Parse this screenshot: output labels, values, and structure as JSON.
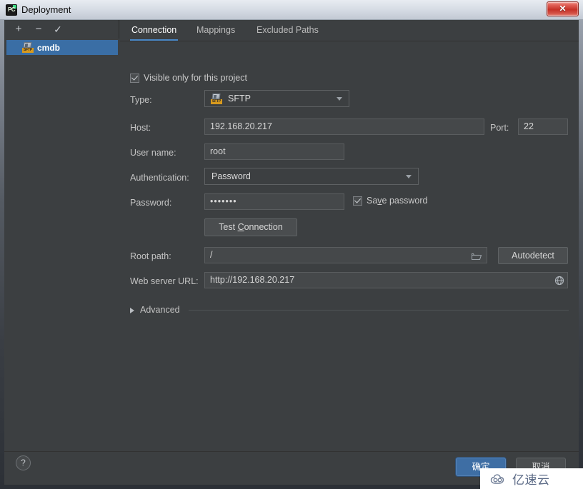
{
  "window": {
    "title": "Deployment",
    "app_icon": "pycharm-logo-icon",
    "close_label": "✕"
  },
  "sidebar": {
    "toolbar": [
      {
        "name": "add-server-button",
        "glyph": "+"
      },
      {
        "name": "remove-server-button",
        "glyph": "−"
      },
      {
        "name": "set-default-server-button",
        "glyph": "✓"
      }
    ],
    "items": [
      {
        "label": "cmdb",
        "icon": "sftp-server-icon",
        "badge": "SFTP",
        "selected": true
      }
    ]
  },
  "main": {
    "tabs": [
      {
        "label": "Connection",
        "active": true
      },
      {
        "label": "Mappings",
        "active": false
      },
      {
        "label": "Excluded Paths",
        "active": false
      }
    ],
    "visible_only_checkbox": {
      "label": "Visible only for this project",
      "checked": true
    },
    "fields": {
      "type": {
        "label": "Type:",
        "value": "SFTP",
        "icon": "sftp-server-icon"
      },
      "host": {
        "label": "Host:",
        "value": "192.168.20.217"
      },
      "port": {
        "label": "Port:",
        "value": "22"
      },
      "user_name": {
        "label": "User name:",
        "value": "root"
      },
      "authentication": {
        "label": "Authentication:",
        "value": "Password"
      },
      "password": {
        "label": "Password:",
        "value": "•••••••"
      },
      "root_path": {
        "label": "Root path:",
        "value": "/",
        "browse_icon": "folder-icon"
      },
      "web_server_url": {
        "label": "Web server URL:",
        "value": "http://192.168.20.217",
        "browse_icon": "globe-icon"
      }
    },
    "save_password_checkbox": {
      "label_before": "Sa",
      "label_mnemonic": "v",
      "label_after": "e password",
      "checked": true
    },
    "test_connection_button": {
      "label_before": "Test ",
      "label_mnemonic": "C",
      "label_after": "onnection"
    },
    "autodetect_button": {
      "label": "Autodetect"
    },
    "advanced_section": {
      "label": "Advanced",
      "expanded": false
    }
  },
  "footer": {
    "help_button": {
      "label": "?"
    },
    "ok_button": {
      "label": "确定"
    },
    "cancel_button": {
      "label": "取消"
    }
  },
  "watermark": {
    "text": "亿速云",
    "icon": "cloud-icon"
  },
  "colors": {
    "accent": "#4a88c7",
    "selection": "#3a6ea5",
    "dialog_bg": "#3c3f41",
    "ok_button": "#3e6ea4",
    "sftp_badge": "#d89a1e"
  }
}
